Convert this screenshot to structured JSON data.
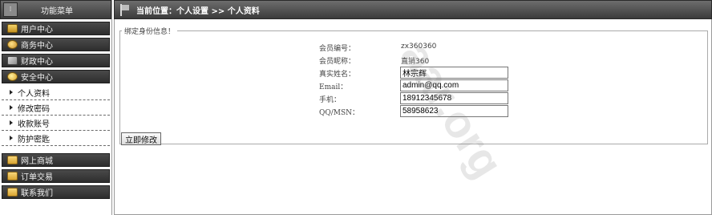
{
  "sidebar": {
    "header_title": "功能菜单",
    "sections_top": [
      {
        "label": "用户中心",
        "icon": "user-icon"
      },
      {
        "label": "商务中心",
        "icon": "business-icon"
      },
      {
        "label": "财政中心",
        "icon": "finance-icon"
      },
      {
        "label": "安全中心",
        "icon": "security-icon"
      }
    ],
    "security_items": [
      {
        "label": "个人资料"
      },
      {
        "label": "修改密码"
      },
      {
        "label": "收款账号"
      },
      {
        "label": "防护密匙"
      }
    ],
    "sections_bottom": [
      {
        "label": "网上商城",
        "icon": "folder-icon"
      },
      {
        "label": "订单交易",
        "icon": "folder-icon"
      },
      {
        "label": "联系我们",
        "icon": "folder-icon"
      }
    ]
  },
  "header": {
    "breadcrumb": "当前位置：个人设置 >> 个人资料"
  },
  "form": {
    "legend": "绑定身份信息！",
    "member_id_label": "会员编号：",
    "member_id_value": "zx360360",
    "nickname_label": "会员昵称：",
    "nickname_value": "直销360",
    "realname_label": "真实姓名：",
    "realname_value": "林宗辉",
    "email_label": "Email：",
    "email_value": "admin@qq.com",
    "phone_label": "手机：",
    "phone_value": "18912345678",
    "qq_label": "QQ/MSN：",
    "qq_value": "58958623",
    "submit_label": "立即修改"
  },
  "watermark": "aar.org"
}
